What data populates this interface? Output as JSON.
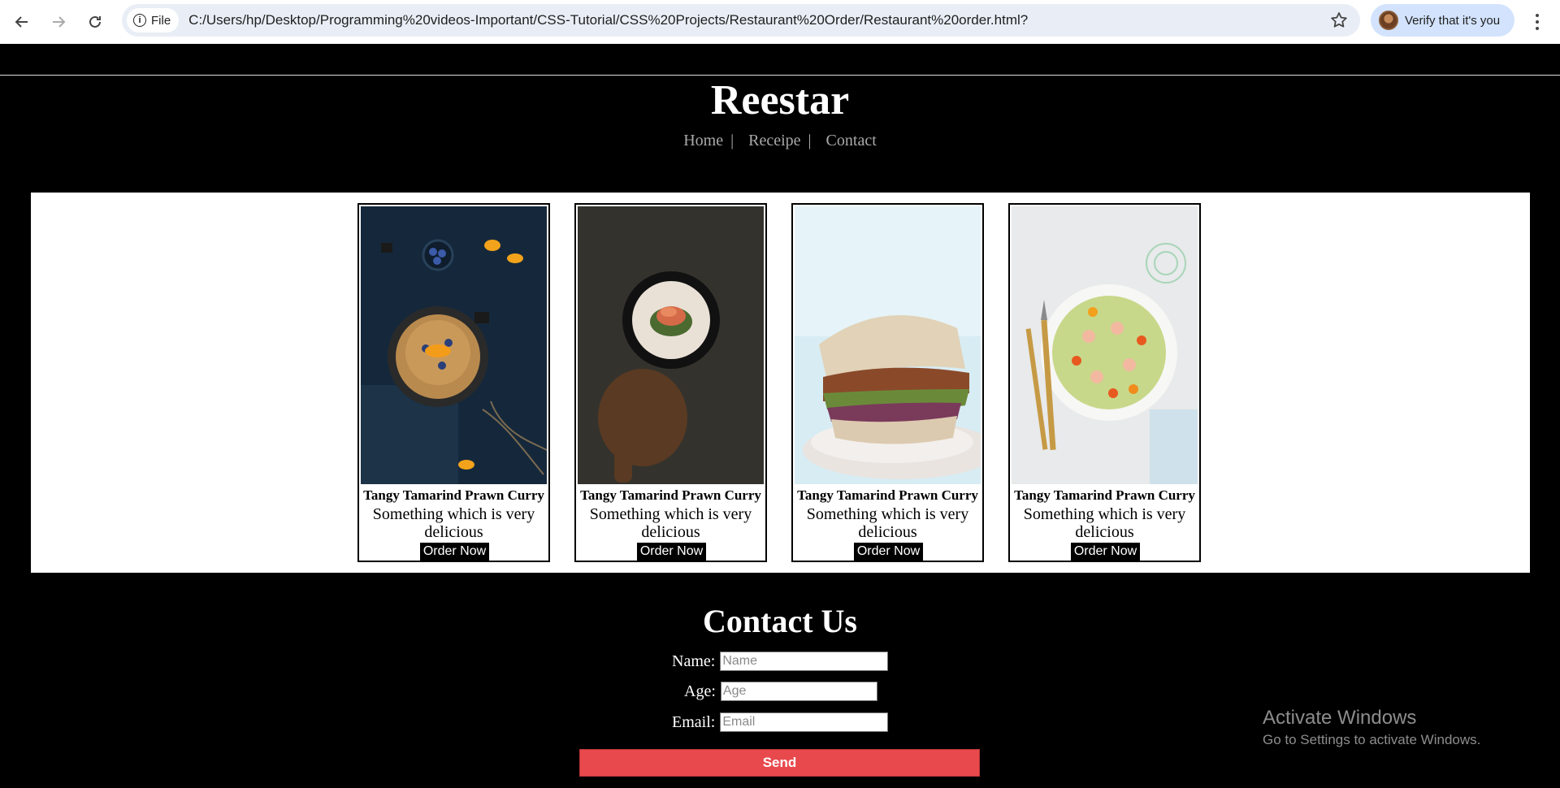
{
  "browser": {
    "back_icon": "arrow-left-icon",
    "forward_icon": "arrow-right-icon",
    "reload_icon": "reload-icon",
    "file_chip_label": "File",
    "url": "C:/Users/hp/Desktop/Programming%20videos-Important/CSS-Tutorial/CSS%20Projects/Restaurant%20Order/Restaurant%20order.html?",
    "bookmark_icon": "star-icon",
    "profile_label": "Verify that it's you",
    "menu_icon": "more-vertical-icon"
  },
  "site": {
    "title": "Reestar",
    "nav": [
      {
        "label": "Home",
        "sep": "|"
      },
      {
        "label": "Receipe",
        "sep": "|"
      },
      {
        "label": "Contact",
        "sep": ""
      }
    ]
  },
  "cards": [
    {
      "name": "Tangy Tamarind Prawn Curry",
      "desc": "Something which is very delicious",
      "button": "Order Now",
      "photo": "oatmeal-with-blueberries-and-orange"
    },
    {
      "name": "Tangy Tamarind Prawn Curry",
      "desc": "Something which is very delicious",
      "button": "Order Now",
      "photo": "salmon-in-bowl-on-wooden-board"
    },
    {
      "name": "Tangy Tamarind Prawn Curry",
      "desc": "Something which is very delicious",
      "button": "Order Now",
      "photo": "chicken-sandwich"
    },
    {
      "name": "Tangy Tamarind Prawn Curry",
      "desc": "Something which is very delicious",
      "button": "Order Now",
      "photo": "caesar-salad-plate"
    }
  ],
  "contact": {
    "title": "Contact Us",
    "name_label": "Name:",
    "name_placeholder": "Name",
    "age_label": "Age:",
    "age_placeholder": "Age",
    "email_label": "Email:",
    "email_placeholder": "Email",
    "send_label": "Send"
  },
  "watermark": {
    "title": "Activate Windows",
    "subtitle": "Go to Settings to activate Windows."
  },
  "colors": {
    "page_bg": "#000000",
    "send_button": "#e8494d",
    "nav_text": "#a9a9a9"
  }
}
